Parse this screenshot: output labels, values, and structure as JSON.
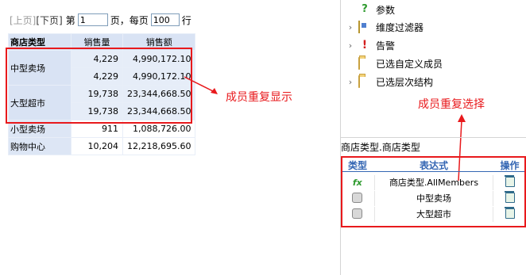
{
  "pager": {
    "prev": "[上页]",
    "next": "[下页]",
    "page_prefix": "第",
    "page_value": "1",
    "page_suffix": "页，每页",
    "per_page_value": "100",
    "per_page_suffix": "行"
  },
  "grid": {
    "headers": [
      "商店类型",
      "销售量",
      "销售额"
    ],
    "groups": [
      {
        "label": "中型卖场",
        "rows": [
          [
            "4,229",
            "4,990,172.10"
          ],
          [
            "4,229",
            "4,990,172.10"
          ]
        ]
      },
      {
        "label": "大型超市",
        "rows": [
          [
            "19,738",
            "23,344,668.50"
          ],
          [
            "19,738",
            "23,344,668.50"
          ]
        ]
      }
    ],
    "single_rows": [
      {
        "label": "小型卖场",
        "values": [
          "911",
          "1,088,726.00"
        ]
      },
      {
        "label": "购物中心",
        "values": [
          "10,204",
          "12,218,695.60"
        ]
      }
    ]
  },
  "annotations": {
    "left": "成员重复显示",
    "right": "成员重复选择",
    "color": "#e8191c"
  },
  "tree": {
    "items": [
      {
        "label": "参数",
        "icon": "question-icon",
        "expandable": false
      },
      {
        "label": "维度过滤器",
        "icon": "filter-icon",
        "expandable": true
      },
      {
        "label": "告警",
        "icon": "alert-icon",
        "expandable": true
      },
      {
        "label": "已选自定义成员",
        "icon": "folder-icon",
        "expandable": false
      },
      {
        "label": "已选层次结构",
        "icon": "folder-icon",
        "expandable": true
      }
    ]
  },
  "member_panel": {
    "title": "商店类型.商店类型",
    "columns": [
      "类型",
      "表达式",
      "操作"
    ],
    "rows": [
      {
        "type_icon": "fx-icon",
        "expression": "商店类型.AllMembers"
      },
      {
        "type_icon": "member-icon",
        "expression": "中型卖场"
      },
      {
        "type_icon": "member-icon",
        "expression": "大型超市"
      }
    ]
  }
}
